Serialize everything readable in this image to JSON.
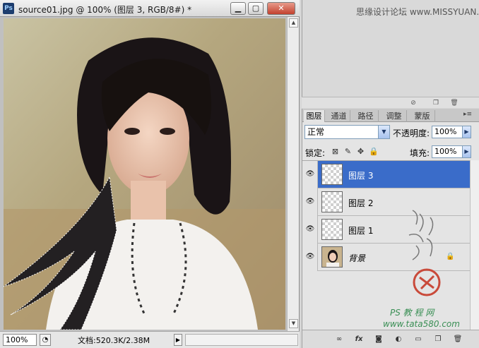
{
  "document": {
    "app_icon": "Ps",
    "title": "source01.jpg @ 100% (图层 3, RGB/8#) *",
    "window_buttons": {
      "minimize": "▁",
      "maximize": "▢",
      "close": "✕"
    },
    "zoom": "100%",
    "doc_size": "文档:520.3K/2.38M",
    "status_arrow": "▶",
    "status_icon": "◔"
  },
  "watermark": "思缘设计论坛 www.MISSYUAN.COM",
  "upper_panel_footer_icons": [
    "no-icon",
    "page-icon",
    "trash-icon"
  ],
  "layers_panel": {
    "tabs": [
      {
        "label": "图层",
        "active": true
      },
      {
        "label": "通道",
        "active": false
      },
      {
        "label": "路径",
        "active": false
      },
      {
        "label": "调整",
        "active": false
      },
      {
        "label": "蒙版",
        "active": false
      }
    ],
    "menu_glyph": "▸≡",
    "blend_mode": "正常",
    "opacity_label": "不透明度:",
    "opacity_value": "100%",
    "lock_label": "锁定:",
    "fill_label": "填充:",
    "fill_value": "100%",
    "layers": [
      {
        "name": "图层 3",
        "selected": true,
        "background": false
      },
      {
        "name": "图层 2",
        "selected": false,
        "background": false
      },
      {
        "name": "图层 1",
        "selected": false,
        "background": false
      },
      {
        "name": "背景",
        "selected": false,
        "background": true
      }
    ]
  },
  "side_calligraphy": "他她我帮你",
  "tutorial_mark": "PS 教 程 网",
  "tutorial_url": "www.tata580.com",
  "colors": {
    "selected_layer": "#3a6cc9",
    "close_button": "#c2412e",
    "tutorial_green": "#3a8f55"
  }
}
